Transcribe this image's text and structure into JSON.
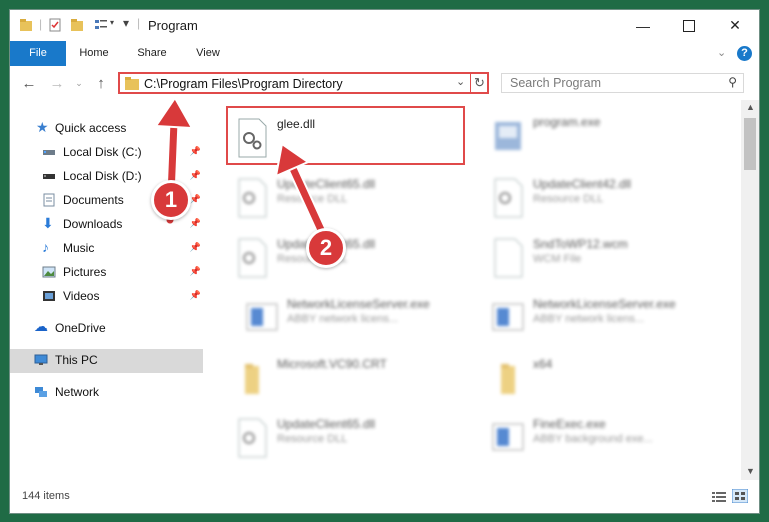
{
  "window": {
    "title": "Program"
  },
  "ribbon": {
    "tabs": [
      "File",
      "Home",
      "Share",
      "View"
    ]
  },
  "address": {
    "path": "C:\\Program Files\\Program Directory"
  },
  "search": {
    "placeholder": "Search Program"
  },
  "nav": {
    "quick_access": "Quick access",
    "items": [
      {
        "label": "Local Disk (C:)",
        "icon": "drive-icon",
        "pinned": true
      },
      {
        "label": "Local Disk (D:)",
        "icon": "drive-icon",
        "pinned": true
      },
      {
        "label": "Documents",
        "icon": "documents-icon",
        "pinned": true
      },
      {
        "label": "Downloads",
        "icon": "downloads-icon",
        "pinned": true
      },
      {
        "label": "Music",
        "icon": "music-icon",
        "pinned": true
      },
      {
        "label": "Pictures",
        "icon": "pictures-icon",
        "pinned": true
      },
      {
        "label": "Videos",
        "icon": "videos-icon",
        "pinned": true
      }
    ],
    "onedrive": "OneDrive",
    "this_pc": "This PC",
    "network": "Network"
  },
  "files": [
    {
      "name": "glee.dll",
      "desc": "",
      "icon": "dll-icon"
    },
    {
      "name": "program.exe",
      "desc": "",
      "icon": "exe-icon"
    },
    {
      "name": "UpdateClient65.dll",
      "desc": "Resource DLL",
      "icon": "dll-icon"
    },
    {
      "name": "UpdateClient42.dll",
      "desc": "Resource DLL",
      "icon": "dll-icon"
    },
    {
      "name": "UpdateClient65.dll",
      "desc": "Resource DLL",
      "icon": "dll-icon"
    },
    {
      "name": "SndToWP12.wcm",
      "desc": "WCM File",
      "icon": "file-icon"
    },
    {
      "name": "NetworkLicenseServer.exe",
      "desc": "ABBY network licens...",
      "icon": "app-icon"
    },
    {
      "name": "NetworkLicenseServer.exe",
      "desc": "ABBY network licens...",
      "icon": "app-icon"
    },
    {
      "name": "Microsoft.VC90.CRT",
      "desc": "",
      "icon": "folder-icon"
    },
    {
      "name": "x64",
      "desc": "",
      "icon": "folder-icon"
    },
    {
      "name": "UpdateClient65.dll",
      "desc": "Resource DLL",
      "icon": "dll-icon"
    },
    {
      "name": "FineExec.exe",
      "desc": "ABBY background exe...",
      "icon": "app-icon"
    }
  ],
  "status": {
    "count": "144 items"
  },
  "annotations": {
    "step1": "1",
    "step2": "2"
  },
  "colors": {
    "accent": "#1979ca",
    "highlight": "#e04a4a",
    "badge": "#d8393a"
  }
}
